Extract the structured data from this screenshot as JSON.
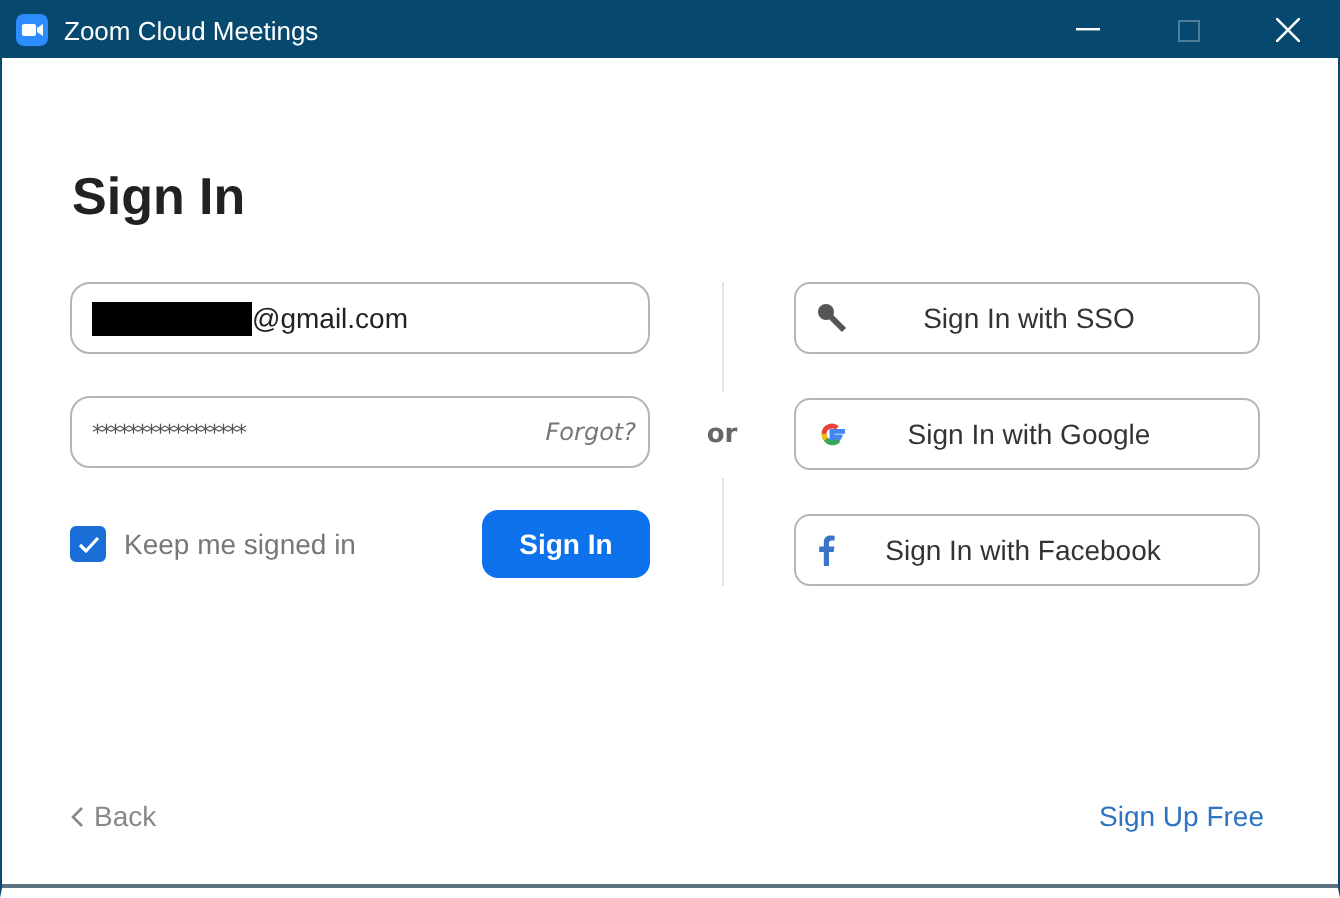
{
  "window": {
    "title": "Zoom Cloud Meetings"
  },
  "heading": "Sign In",
  "email": {
    "value": "@gmail.com",
    "redacted": true
  },
  "password": {
    "value": "*****************",
    "link": "Forgot?"
  },
  "keep_signed_in": {
    "label": "Keep me signed in",
    "checked": true
  },
  "sign_in_button": "Sign In",
  "divider_label": "or",
  "providers": [
    {
      "kind": "sso",
      "label": "Sign In with SSO"
    },
    {
      "kind": "google",
      "label": "Sign In with Google"
    },
    {
      "kind": "facebook",
      "label": "Sign In with Facebook"
    }
  ],
  "back": "Back",
  "sign_up": "Sign Up Free"
}
